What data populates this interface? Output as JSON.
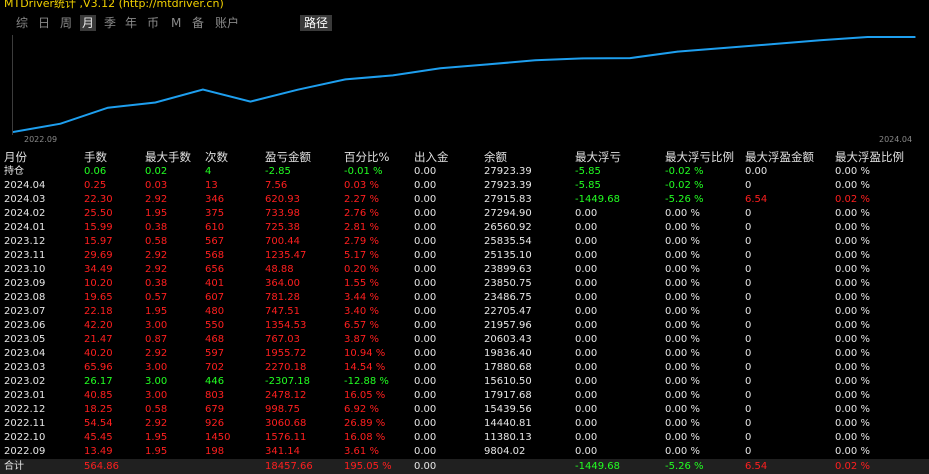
{
  "window": {
    "title": "MTDriver统计 ,V3.12 (http://mtdriver.cn)"
  },
  "tabs": [
    {
      "label": "综",
      "active": false
    },
    {
      "label": "日",
      "active": false
    },
    {
      "label": "周",
      "active": false
    },
    {
      "label": "月",
      "active": true
    },
    {
      "label": "季",
      "active": false
    },
    {
      "label": "年",
      "active": false
    },
    {
      "label": "币",
      "active": false
    },
    {
      "label": "M",
      "active": false
    },
    {
      "label": "备",
      "active": false
    },
    {
      "label": "账户",
      "active": false
    },
    {
      "label": "路径",
      "active": false,
      "highlight": true
    }
  ],
  "chart_data": {
    "type": "line",
    "x": [
      "2022.09",
      "2022.10",
      "2022.11",
      "2022.12",
      "2023.01",
      "2023.02",
      "2023.03",
      "2023.04",
      "2023.05",
      "2023.06",
      "2023.07",
      "2023.08",
      "2023.09",
      "2023.10",
      "2023.11",
      "2023.12",
      "2024.01",
      "2024.02",
      "2024.03",
      "2024.04"
    ],
    "values": [
      9804.02,
      11380.13,
      14440.81,
      15439.56,
      17917.68,
      15610.5,
      17880.68,
      19836.4,
      20603.43,
      21957.96,
      22705.47,
      23486.75,
      23850.75,
      23899.63,
      25135.1,
      25835.54,
      26560.92,
      27294.9,
      27915.83,
      27923.39
    ],
    "x_tick_labels": [
      "2022.09",
      "2024.04"
    ],
    "line_color": "#1e9fef",
    "grid": false
  },
  "table": {
    "headers": [
      "月份",
      "手数",
      "最大手数",
      "次数",
      "盈亏金额",
      "百分比%",
      "出入金",
      "余额",
      "最大浮亏",
      "最大浮亏比例",
      "最大浮盈金额",
      "最大浮盈比例"
    ],
    "holding": {
      "label": "持仓",
      "cells": [
        "0.06",
        "0.02",
        "4",
        "-2.85",
        "-0.01 %",
        "0.00",
        "27923.39",
        "-5.85",
        "-0.02 %",
        "0.00",
        "0.00 %"
      ]
    },
    "rows": [
      {
        "month": "2024.04",
        "cells": [
          "0.25",
          "0.03",
          "13",
          "7.56",
          "0.03 %",
          "0.00",
          "27923.39",
          "-5.85",
          "-0.02 %",
          "0",
          "0.00 %"
        ]
      },
      {
        "month": "2024.03",
        "cells": [
          "22.30",
          "2.92",
          "346",
          "620.93",
          "2.27 %",
          "0.00",
          "27915.83",
          "-1449.68",
          "-5.26 %",
          "6.54",
          "0.02 %"
        ]
      },
      {
        "month": "2024.02",
        "cells": [
          "25.50",
          "1.95",
          "375",
          "733.98",
          "2.76 %",
          "0.00",
          "27294.90",
          "0.00",
          "0.00 %",
          "0",
          "0.00 %"
        ]
      },
      {
        "month": "2024.01",
        "cells": [
          "15.99",
          "0.38",
          "610",
          "725.38",
          "2.81 %",
          "0.00",
          "26560.92",
          "0.00",
          "0.00 %",
          "0",
          "0.00 %"
        ]
      },
      {
        "month": "2023.12",
        "cells": [
          "15.97",
          "0.58",
          "567",
          "700.44",
          "2.79 %",
          "0.00",
          "25835.54",
          "0.00",
          "0.00 %",
          "0",
          "0.00 %"
        ]
      },
      {
        "month": "2023.11",
        "cells": [
          "29.69",
          "2.92",
          "568",
          "1235.47",
          "5.17 %",
          "0.00",
          "25135.10",
          "0.00",
          "0.00 %",
          "0",
          "0.00 %"
        ]
      },
      {
        "month": "2023.10",
        "cells": [
          "34.49",
          "2.92",
          "656",
          "48.88",
          "0.20 %",
          "0.00",
          "23899.63",
          "0.00",
          "0.00 %",
          "0",
          "0.00 %"
        ]
      },
      {
        "month": "2023.09",
        "cells": [
          "10.20",
          "0.38",
          "401",
          "364.00",
          "1.55 %",
          "0.00",
          "23850.75",
          "0.00",
          "0.00 %",
          "0",
          "0.00 %"
        ]
      },
      {
        "month": "2023.08",
        "cells": [
          "19.65",
          "0.57",
          "607",
          "781.28",
          "3.44 %",
          "0.00",
          "23486.75",
          "0.00",
          "0.00 %",
          "0",
          "0.00 %"
        ]
      },
      {
        "month": "2023.07",
        "cells": [
          "22.18",
          "1.95",
          "480",
          "747.51",
          "3.40 %",
          "0.00",
          "22705.47",
          "0.00",
          "0.00 %",
          "0",
          "0.00 %"
        ]
      },
      {
        "month": "2023.06",
        "cells": [
          "42.20",
          "3.00",
          "550",
          "1354.53",
          "6.57 %",
          "0.00",
          "21957.96",
          "0.00",
          "0.00 %",
          "0",
          "0.00 %"
        ]
      },
      {
        "month": "2023.05",
        "cells": [
          "21.47",
          "0.87",
          "468",
          "767.03",
          "3.87 %",
          "0.00",
          "20603.43",
          "0.00",
          "0.00 %",
          "0",
          "0.00 %"
        ]
      },
      {
        "month": "2023.04",
        "cells": [
          "40.20",
          "2.92",
          "597",
          "1955.72",
          "10.94 %",
          "0.00",
          "19836.40",
          "0.00",
          "0.00 %",
          "0",
          "0.00 %"
        ]
      },
      {
        "month": "2023.03",
        "cells": [
          "65.96",
          "3.00",
          "702",
          "2270.18",
          "14.54 %",
          "0.00",
          "17880.68",
          "0.00",
          "0.00 %",
          "0",
          "0.00 %"
        ]
      },
      {
        "month": "2023.02",
        "cells": [
          "26.17",
          "3.00",
          "446",
          "-2307.18",
          "-12.88 %",
          "0.00",
          "15610.50",
          "0.00",
          "0.00 %",
          "0",
          "0.00 %"
        ]
      },
      {
        "month": "2023.01",
        "cells": [
          "40.85",
          "3.00",
          "803",
          "2478.12",
          "16.05 %",
          "0.00",
          "17917.68",
          "0.00",
          "0.00 %",
          "0",
          "0.00 %"
        ]
      },
      {
        "month": "2022.12",
        "cells": [
          "18.25",
          "0.58",
          "679",
          "998.75",
          "6.92 %",
          "0.00",
          "15439.56",
          "0.00",
          "0.00 %",
          "0",
          "0.00 %"
        ]
      },
      {
        "month": "2022.11",
        "cells": [
          "54.54",
          "2.92",
          "926",
          "3060.68",
          "26.89 %",
          "0.00",
          "14440.81",
          "0.00",
          "0.00 %",
          "0",
          "0.00 %"
        ]
      },
      {
        "month": "2022.10",
        "cells": [
          "45.45",
          "1.95",
          "1450",
          "1576.11",
          "16.08 %",
          "0.00",
          "11380.13",
          "0.00",
          "0.00 %",
          "0",
          "0.00 %"
        ]
      },
      {
        "month": "2022.09",
        "cells": [
          "13.49",
          "1.95",
          "198",
          "341.14",
          "3.61 %",
          "0.00",
          "9804.02",
          "0.00",
          "0.00 %",
          "0",
          "0.00 %"
        ]
      }
    ],
    "total": {
      "label": "合计",
      "cells": [
        "564.86",
        "",
        "",
        "18457.66",
        "195.05 %",
        "0.00",
        "",
        "-1449.68",
        "-5.26 %",
        "6.54",
        "0.02 %"
      ]
    }
  },
  "colors": {
    "positive": "#ff1f1f",
    "negative": "#22ff22",
    "holding_highlight": "#f0f000",
    "neutral": "#e6e6e6"
  }
}
